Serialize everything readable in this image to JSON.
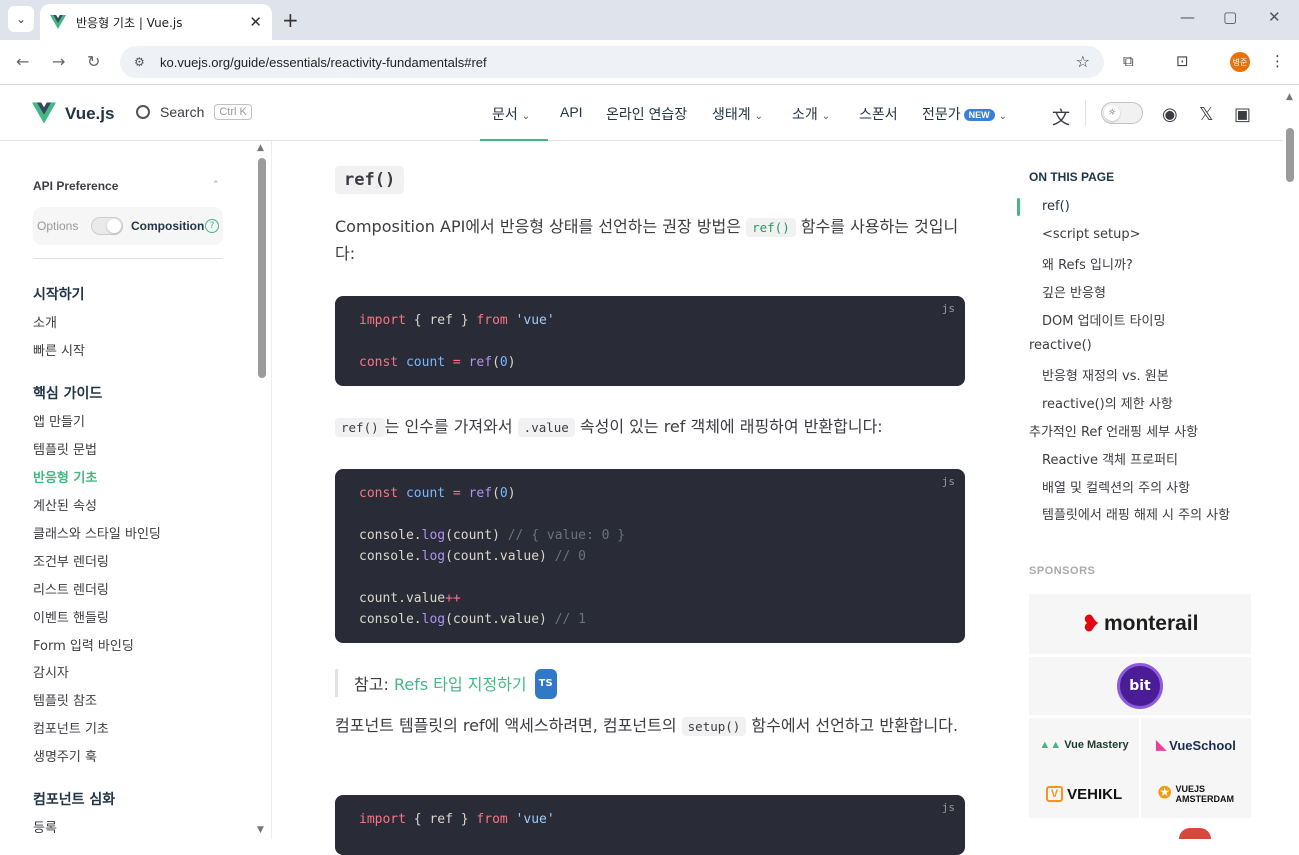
{
  "browser": {
    "tab_title": "반응형 기초 | Vue.js",
    "url": "ko.vuejs.org/guide/essentials/reactivity-fundamentals#ref",
    "profile_initials": "병준"
  },
  "nav": {
    "brand": "Vue.js",
    "search_label": "Search",
    "search_shortcut": "Ctrl K",
    "links": [
      "문서",
      "API",
      "온라인 연습장",
      "생태계",
      "소개",
      "스폰서",
      "전문가"
    ],
    "new_badge": "NEW"
  },
  "sidebar": {
    "api_pref_title": "API Preference",
    "options_label": "Options",
    "composition_label": "Composition",
    "help_glyph": "?",
    "sections": [
      {
        "title": "시작하기",
        "items": [
          "소개",
          "빠른 시작"
        ]
      },
      {
        "title": "핵심 가이드",
        "items": [
          "앱 만들기",
          "템플릿 문법",
          "반응형 기초",
          "계산된 속성",
          "클래스와 스타일 바인딩",
          "조건부 렌더링",
          "리스트 렌더링",
          "이벤트 핸들링",
          "Form 입력 바인딩",
          "감시자",
          "템플릿 참조",
          "컴포넌트 기초",
          "생명주기 훅"
        ]
      },
      {
        "title": "컴포넌트 심화",
        "items": [
          "등록"
        ]
      }
    ],
    "active_item": "반응형 기초"
  },
  "content": {
    "heading": "ref()",
    "p1_before": "Composition API에서 반응형 상태를 선언하는 권장 방법은",
    "p1_code": "ref()",
    "p1_after": "함수를 사용하는 것입니다:",
    "code_lang": "js",
    "code1": {
      "l1": [
        "import",
        " { ref } ",
        "from",
        " 'vue'"
      ],
      "l2": [
        "const",
        " count",
        " = ",
        "ref",
        "(",
        "0",
        ")"
      ]
    },
    "p2_code1": "ref()",
    "p2_mid": "는 인수를 가져와서",
    "p2_code2": ".value",
    "p2_after": "속성이 있는 ref 객체에 래핑하여 반환합니다:",
    "code2": {
      "l1": [
        "const",
        " count",
        " = ",
        "ref",
        "(",
        "0",
        ")"
      ],
      "l2": [
        "console.",
        "log",
        "(count) ",
        "// { value: 0 }"
      ],
      "l3": [
        "console.",
        "log",
        "(count.value) ",
        "// 0"
      ],
      "l4": [
        "count.value",
        "++"
      ],
      "l5": [
        "console.",
        "log",
        "(count.value) ",
        "// 1"
      ]
    },
    "tip_prefix": "참고:",
    "tip_link": "Refs 타입 지정하기",
    "tip_badge": "TS",
    "p3_before": "컴포넌트 템플릿의 ref에 액세스하려면, 컴포넌트의",
    "p3_code": "setup()",
    "p3_after": "함수에서 선언하고 반환합니다.",
    "code3": {
      "l1": [
        "import",
        " { ref } ",
        "from",
        " 'vue'"
      ]
    }
  },
  "toc": {
    "title": "ON THIS PAGE",
    "items": [
      "ref()",
      "<script setup>",
      "왜 Refs 입니까?",
      "깊은 반응형",
      "DOM 업데이트 타이밍",
      "reactive()",
      "반응형 재정의 vs. 원본",
      "reactive()의 제한 사항",
      "추가적인 Ref 언래핑 세부 사항",
      "Reactive 객체 프로퍼티",
      "배열 및 컬렉션의 주의 사항",
      "템플릿에서 래핑 해제 시 주의 사항"
    ]
  },
  "sponsors": {
    "title": "SPONSORS",
    "monterail": "monterail",
    "bit": "bit",
    "vue_mastery": "Vue Mastery",
    "vue_school": "VueSchool",
    "vehikl": "VEHIKL",
    "vuejs_amsterdam_1": "VUEJS",
    "vuejs_amsterdam_2": "AMSTERDAM"
  },
  "colors": {
    "accent": "#42b883",
    "code_bg": "#292b37",
    "tab_bar": "#dfe3eb"
  }
}
